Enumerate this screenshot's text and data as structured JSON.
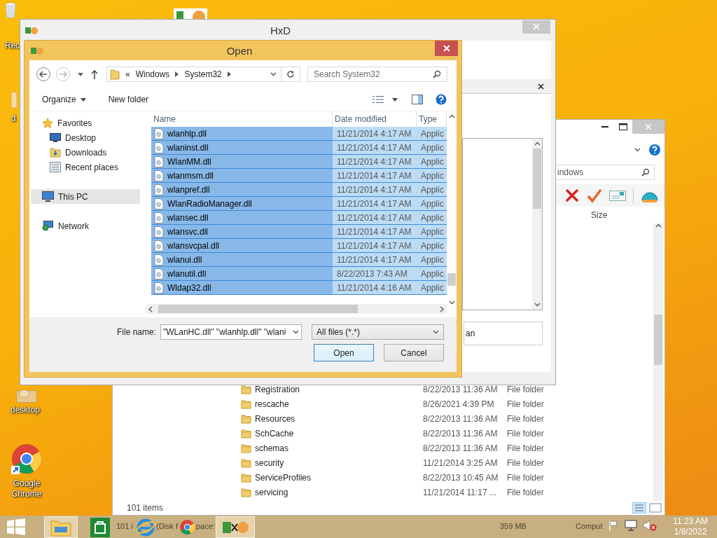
{
  "desktop_icons": [
    {
      "kind": "recycle",
      "label": "Rec"
    },
    {
      "kind": "generic",
      "label": "d"
    },
    {
      "kind": "package",
      "label": "desktop"
    },
    {
      "kind": "browser",
      "label": "Google Chrome"
    }
  ],
  "explorer_window": {
    "search_text": "indows",
    "size_column": "Size",
    "rows": [
      {
        "name": "Registration",
        "date": "8/22/2013 11:36 AM",
        "type": "File folder"
      },
      {
        "name": "rescache",
        "date": "8/26/2021 4:39 PM",
        "type": "File folder"
      },
      {
        "name": "Resources",
        "date": "8/22/2013 11:36 AM",
        "type": "File folder"
      },
      {
        "name": "SchCache",
        "date": "8/22/2013 11:36 AM",
        "type": "File folder"
      },
      {
        "name": "schemas",
        "date": "8/22/2013 11:36 AM",
        "type": "File folder"
      },
      {
        "name": "security",
        "date": "11/21/2014 3:25 AM",
        "type": "File folder"
      },
      {
        "name": "ServiceProfiles",
        "date": "8/22/2013 10:45 AM",
        "type": "File folder"
      },
      {
        "name": "servicing",
        "date": "11/21/2014 11:17 ...",
        "type": "File folder"
      }
    ],
    "status": "101 items"
  },
  "hxd_window": {
    "title": "HxD",
    "field_text": "an"
  },
  "open_dialog": {
    "title": "Open",
    "overflow": "«",
    "path": [
      "Windows",
      "System32"
    ],
    "search_placeholder": "Search System32",
    "toolbar": [
      "Organize",
      "New folder"
    ],
    "nav": [
      {
        "kind": "star",
        "label": "Favorites",
        "selected": false,
        "children": [
          {
            "kind": "desktop",
            "label": "Desktop",
            "selected": false
          },
          {
            "kind": "downloads",
            "label": "Downloads",
            "selected": false
          },
          {
            "kind": "recent",
            "label": "Recent places",
            "selected": false
          }
        ]
      },
      {
        "kind": "pc",
        "label": "This PC",
        "selected": true
      },
      {
        "kind": "network",
        "label": "Network",
        "selected": false
      }
    ],
    "columns": [
      "Name",
      "Date modified",
      "Type"
    ],
    "rows": [
      {
        "name": "wlanhlp.dll",
        "date": "11/21/2014 4:17 AM",
        "type": "Applic",
        "selected": true
      },
      {
        "name": "wlaninst.dll",
        "date": "11/21/2014 4:17 AM",
        "type": "Applic",
        "selected": true
      },
      {
        "name": "WlanMM.dll",
        "date": "11/21/2014 4:17 AM",
        "type": "Applic",
        "selected": true
      },
      {
        "name": "wlanmsm.dll",
        "date": "11/21/2014 4:17 AM",
        "type": "Applic",
        "selected": true
      },
      {
        "name": "wlanpref.dll",
        "date": "11/21/2014 4:17 AM",
        "type": "Applic",
        "selected": true
      },
      {
        "name": "WlanRadioManager.dll",
        "date": "11/21/2014 4:17 AM",
        "type": "Applic",
        "selected": true
      },
      {
        "name": "wlansec.dll",
        "date": "11/21/2014 4:17 AM",
        "type": "Applic",
        "selected": true
      },
      {
        "name": "wlansvc.dll",
        "date": "11/21/2014 4:17 AM",
        "type": "Applic",
        "selected": true
      },
      {
        "name": "wlansvcpal.dll",
        "date": "11/21/2014 4:17 AM",
        "type": "Applic",
        "selected": true
      },
      {
        "name": "wlanui.dll",
        "date": "11/21/2014 4:17 AM",
        "type": "Applic",
        "selected": true
      },
      {
        "name": "wlanutil.dll",
        "date": "8/22/2013 7:43 AM",
        "type": "Applic",
        "selected": true
      },
      {
        "name": "Wldap32.dll",
        "date": "11/21/2014 4:16 AM",
        "type": "Applic",
        "selected": true
      }
    ],
    "file_name_label": "File name:",
    "file_name": "\"WLanHC.dll\" \"wlanhlp.dll\" \"wlani",
    "filter": "All files (*.*)",
    "buttons": [
      {
        "kind": "default",
        "label": "Open"
      },
      {
        "kind": "normal",
        "label": "Cancel"
      }
    ]
  },
  "taskbar": {
    "apps": [
      {
        "kind": "explorer",
        "open": true
      },
      {
        "kind": "store",
        "open": false
      },
      {
        "kind": "ie",
        "open": false
      },
      {
        "kind": "chrome",
        "open": false
      },
      {
        "kind": "hxd",
        "open": true
      }
    ],
    "see_through": [
      "101 i",
      "(Disk f",
      "pace:",
      "359 MB",
      "Comput"
    ],
    "time": "11:23 AM",
    "date": "1/8/2022"
  }
}
